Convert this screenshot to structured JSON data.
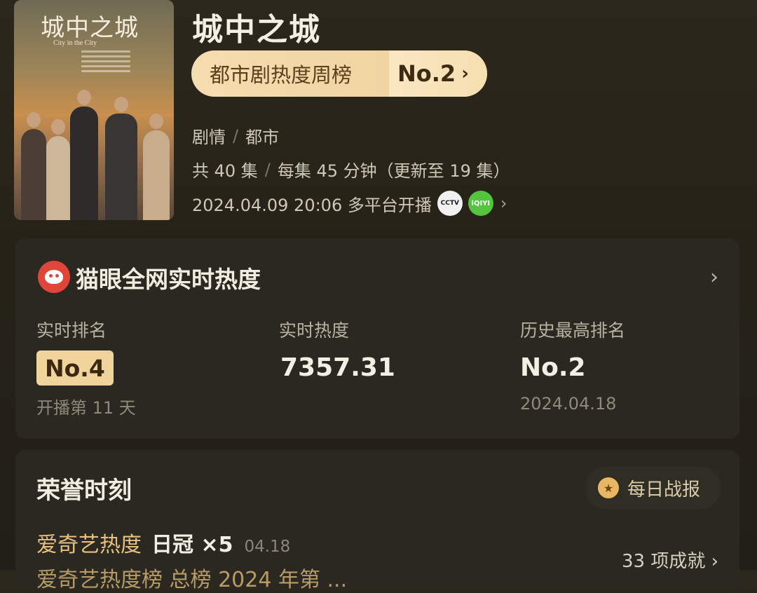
{
  "header": {
    "poster_title": "城中之城",
    "poster_subtitle": "City in the City",
    "title": "城中之城",
    "chart_rank": {
      "label": "都市剧热度周榜",
      "value": "No.2",
      "chevron": "›"
    },
    "genres": [
      "剧情",
      "都市"
    ],
    "genre_sep": "/",
    "episodes": "共 40 集",
    "duration": "每集 45 分钟（更新至 19 集）",
    "premiere": "2024.04.09 20:06 多平台开播",
    "platform_logos": [
      {
        "name": "cctv-icon",
        "text": "CCTV"
      },
      {
        "name": "iqiyi-icon",
        "text": "iQIYI"
      }
    ]
  },
  "heat_card": {
    "title": "猫眼全网实时热度",
    "stats": [
      {
        "label": "实时排名",
        "value": "No.4",
        "sub": "开播第 11 天"
      },
      {
        "label": "实时热度",
        "value": "7357.31",
        "sub": ""
      },
      {
        "label": "历史最高排名",
        "value": "No.2",
        "sub": "2024.04.18"
      }
    ]
  },
  "honor_card": {
    "title": "荣誉时刻",
    "daily_report": "每日战报",
    "achievements": [
      {
        "source": "爱奇艺热度",
        "achievement": "日冠 ×5",
        "date": "04.18"
      }
    ],
    "second_row_partial": "爱奇艺热度榜 总榜 2024 年第 ...",
    "achievement_count": "33 项成就 ›"
  },
  "colors": {
    "background": "#262218",
    "pill": "#f1d49c",
    "accent_text": "#e6c27e",
    "maoyan_red": "#e0453a",
    "iqiyi_green": "#54c43f"
  }
}
